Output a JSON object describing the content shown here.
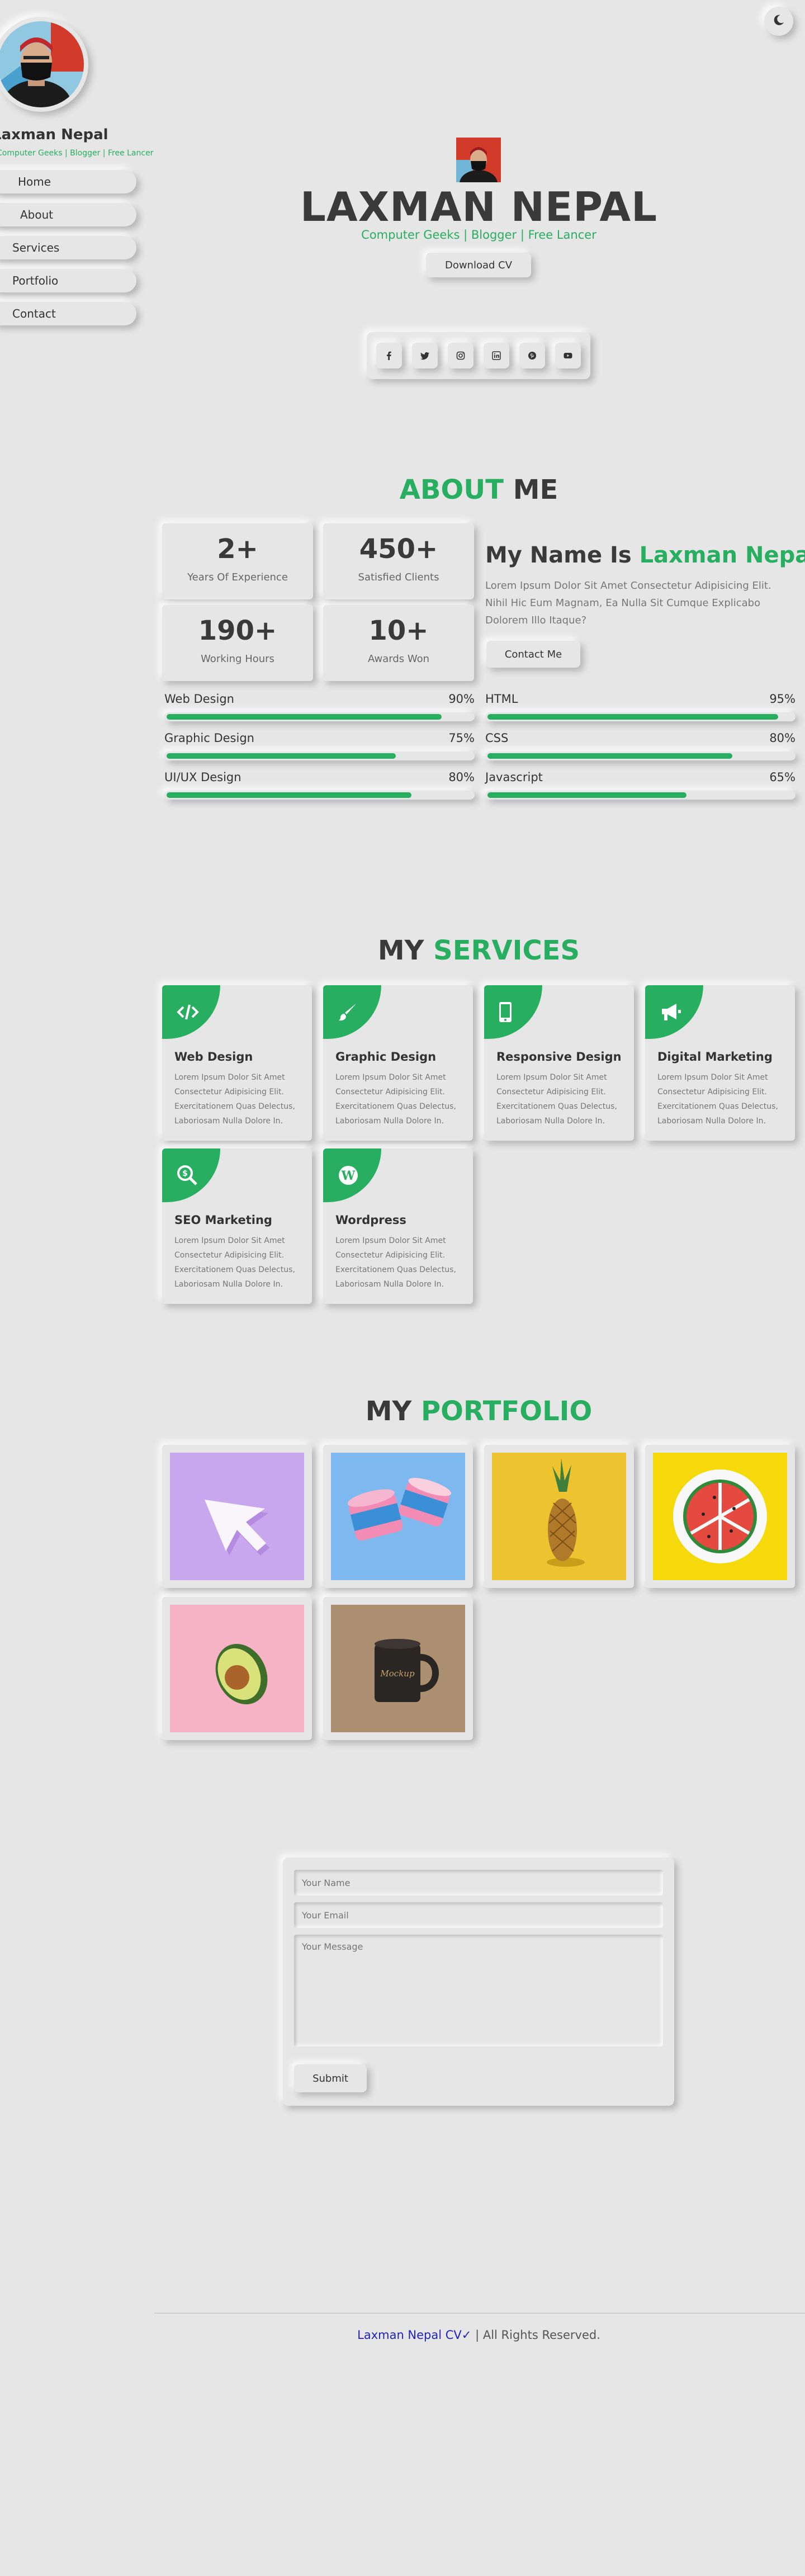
{
  "colors": {
    "accent": "#27ae60",
    "background": "#e6e6e6",
    "text": "#3a3a3a",
    "link": "#2222bb"
  },
  "sidebar": {
    "name": "Laxman Nepal",
    "tagline": "Computer Geeks | Blogger | Free Lancer",
    "nav": [
      {
        "label": "Home"
      },
      {
        "label": "About"
      },
      {
        "label": "Services"
      },
      {
        "label": "Portfolio"
      },
      {
        "label": "Contact"
      }
    ]
  },
  "theme_toggle": {
    "icon": "moon-icon"
  },
  "hero": {
    "name": "LAXMAN NEPAL",
    "tagline": "Computer Geeks | Blogger | Free Lancer",
    "download_label": "Download CV",
    "social": [
      "facebook-icon",
      "twitter-icon",
      "instagram-icon",
      "linkedin-icon",
      "pinterest-icon",
      "youtube-icon"
    ]
  },
  "about": {
    "title_accent": "ABOUT",
    "title_rest": "ME",
    "stats": [
      {
        "value": "2+",
        "label": "Years Of Experience"
      },
      {
        "value": "450+",
        "label": "Satisfied Clients"
      },
      {
        "value": "190+",
        "label": "Working Hours"
      },
      {
        "value": "10+",
        "label": "Awards Won"
      }
    ],
    "heading_prefix": "My Name Is",
    "heading_name": "Laxman Nepal",
    "text": "Lorem Ipsum Dolor Sit Amet Consectetur Adipisicing Elit. Nihil Hic Eum Magnam, Ea Nulla Sit Cumque Explicabo Dolorem Illo Itaque?",
    "contact_label": "Contact Me",
    "skills": [
      {
        "name": "Web Design",
        "percent_label": "90%",
        "percent": 90
      },
      {
        "name": "HTML",
        "percent_label": "95%",
        "percent": 95
      },
      {
        "name": "Graphic Design",
        "percent_label": "75%",
        "percent": 75
      },
      {
        "name": "CSS",
        "percent_label": "80%",
        "percent": 80
      },
      {
        "name": "UI/UX Design",
        "percent_label": "80%",
        "percent": 80
      },
      {
        "name": "Javascript",
        "percent_label": "65%",
        "percent": 65
      }
    ]
  },
  "services": {
    "title_rest": "MY",
    "title_accent": "SERVICES",
    "items": [
      {
        "title": "Web Design",
        "icon": "code-icon",
        "desc": "Lorem Ipsum Dolor Sit Amet Consectetur Adipisicing Elit. Exercitationem Quas Delectus, Laboriosam Nulla Dolore In."
      },
      {
        "title": "Graphic Design",
        "icon": "brush-icon",
        "desc": "Lorem Ipsum Dolor Sit Amet Consectetur Adipisicing Elit. Exercitationem Quas Delectus, Laboriosam Nulla Dolore In."
      },
      {
        "title": "Responsive Design",
        "icon": "mobile-icon",
        "desc": "Lorem Ipsum Dolor Sit Amet Consectetur Adipisicing Elit. Exercitationem Quas Delectus, Laboriosam Nulla Dolore In."
      },
      {
        "title": "Digital Marketing",
        "icon": "megaphone-icon",
        "desc": "Lorem Ipsum Dolor Sit Amet Consectetur Adipisicing Elit. Exercitationem Quas Delectus, Laboriosam Nulla Dolore In."
      },
      {
        "title": "SEO Marketing",
        "icon": "search-dollar-icon",
        "desc": "Lorem Ipsum Dolor Sit Amet Consectetur Adipisicing Elit. Exercitationem Quas Delectus, Laboriosam Nulla Dolore In."
      },
      {
        "title": "Wordpress",
        "icon": "wordpress-icon",
        "desc": "Lorem Ipsum Dolor Sit Amet Consectetur Adipisicing Elit. Exercitationem Quas Delectus, Laboriosam Nulla Dolore In."
      }
    ]
  },
  "portfolio": {
    "title_rest": "MY",
    "title_accent": "PORTFOLIO",
    "items": [
      "cursor-image",
      "ice-cream-cups-image",
      "pineapple-image",
      "watermelon-image",
      "avocado-image",
      "mug-image"
    ]
  },
  "contact": {
    "name_placeholder": "Your Name",
    "email_placeholder": "Your Email",
    "message_placeholder": "Your Message",
    "submit_label": "Submit"
  },
  "footer": {
    "link_text": "Laxman Nepal CV✓",
    "rights": " | All Rights Reserved."
  }
}
